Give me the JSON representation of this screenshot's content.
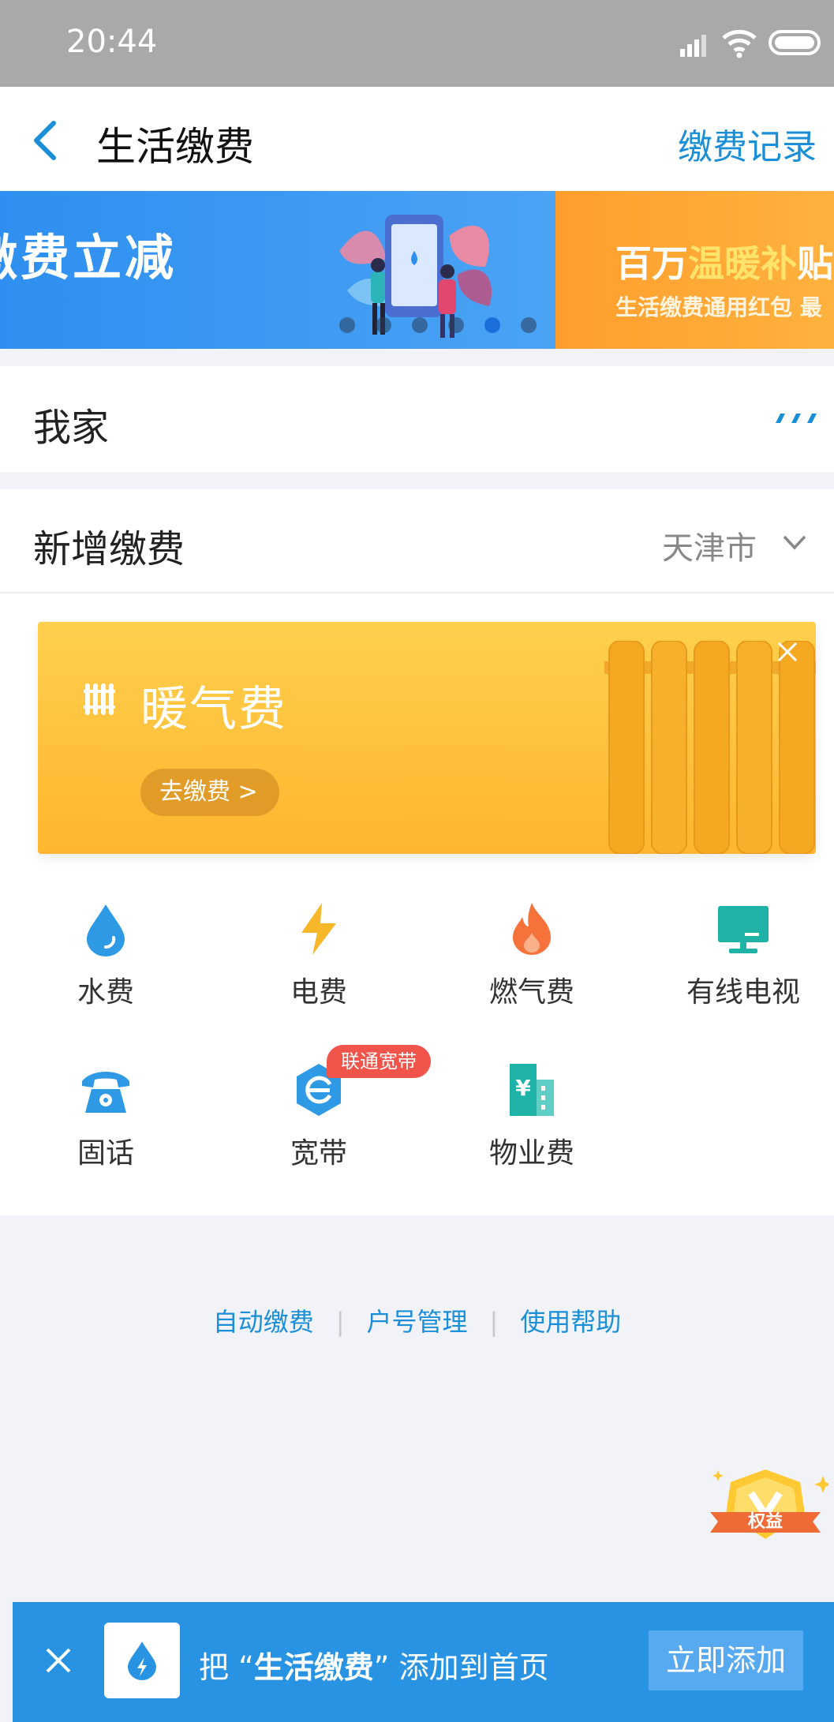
{
  "status_bar": {
    "time": "20:44"
  },
  "nav": {
    "title": "生活缴费",
    "right_action": "缴费记录"
  },
  "banner": {
    "slide_left_text": "缴费立减",
    "slide_right_title_a": "百万",
    "slide_right_title_b": "温暖补",
    "slide_right_title_c": "贴",
    "slide_right_sub": "生活缴费通用红包 最",
    "accent_orange": "#ffb23f"
  },
  "my_home": {
    "label": "我家"
  },
  "new_payment": {
    "label": "新增缴费",
    "city": "天津市",
    "heating_card": {
      "name": "暖气费",
      "button": "去缴费 >"
    },
    "services": [
      {
        "label": "水费",
        "icon": "water-drop-icon"
      },
      {
        "label": "电费",
        "icon": "lightning-icon"
      },
      {
        "label": "燃气费",
        "icon": "flame-icon"
      },
      {
        "label": "有线电视",
        "icon": "tv-icon"
      },
      {
        "label": "固话",
        "icon": "telephone-icon"
      },
      {
        "label": "宽带",
        "icon": "broadband-icon",
        "tag": "联通宽带"
      },
      {
        "label": "物业费",
        "icon": "building-yen-icon"
      }
    ]
  },
  "links": [
    "自动缴费",
    "户号管理",
    "使用帮助"
  ],
  "badge": {
    "text": "权益"
  },
  "add_bar": {
    "prefix": "把 “",
    "app_name": "生活缴费",
    "suffix": "” 添加到首页",
    "button": "立即添加"
  },
  "colors": {
    "primary_blue": "#1a8fd8",
    "tag_red": "#f0544a",
    "heating_yellow": "#ffc23d"
  }
}
